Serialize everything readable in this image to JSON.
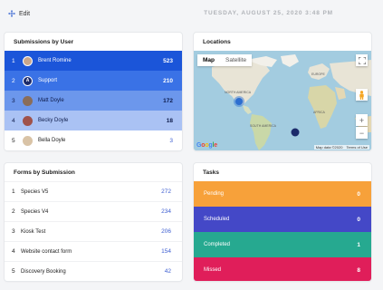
{
  "header": {
    "edit_label": "Edit",
    "date": "TUESDAY, AUGUST 25, 2020 3:48 PM"
  },
  "submissions": {
    "title": "Submissions by User",
    "rows": [
      {
        "num": "1",
        "name": "Brent Romine",
        "count": "523",
        "avatar": "photo",
        "bg": "#1b55d9"
      },
      {
        "num": "2",
        "name": "Support",
        "count": "210",
        "avatar": "A",
        "bg": "#3a72e6"
      },
      {
        "num": "3",
        "name": "Matt Doyle",
        "count": "172",
        "avatar": "photo",
        "bg": "#6c97ec"
      },
      {
        "num": "4",
        "name": "Becky Doyle",
        "count": "18",
        "avatar": "photo",
        "bg": "#aac2f4"
      },
      {
        "num": "5",
        "name": "Bella Doyle",
        "count": "3",
        "avatar": "photo",
        "bg": "#ffffff"
      }
    ]
  },
  "locations": {
    "title": "Locations",
    "tabs": [
      "Map",
      "Satellite"
    ],
    "labels": {
      "north_america": "NORTH AMERICA",
      "south_america": "SOUTH AMERICA",
      "africa": "AFRICA",
      "europe": "EUROPE"
    },
    "footer": [
      "Map data ©2020",
      "Terms of Use"
    ],
    "google": "Google",
    "zoom_in": "+",
    "zoom_out": "−"
  },
  "forms": {
    "title": "Forms by Submission",
    "rows": [
      {
        "num": "1",
        "name": "Species V5",
        "count": "272"
      },
      {
        "num": "2",
        "name": "Species V4",
        "count": "234"
      },
      {
        "num": "3",
        "name": "Kiosk Test",
        "count": "206"
      },
      {
        "num": "4",
        "name": "Website contact form",
        "count": "154"
      },
      {
        "num": "5",
        "name": "Discovery Booking",
        "count": "42"
      }
    ]
  },
  "tasks": {
    "title": "Tasks",
    "rows": [
      {
        "name": "Pending",
        "count": "0",
        "color": "#f7a13a"
      },
      {
        "name": "Scheduled",
        "count": "0",
        "color": "#4448c7"
      },
      {
        "name": "Completed",
        "count": "1",
        "color": "#26a990"
      },
      {
        "name": "Missed",
        "count": "8",
        "color": "#e01e5a"
      }
    ]
  }
}
